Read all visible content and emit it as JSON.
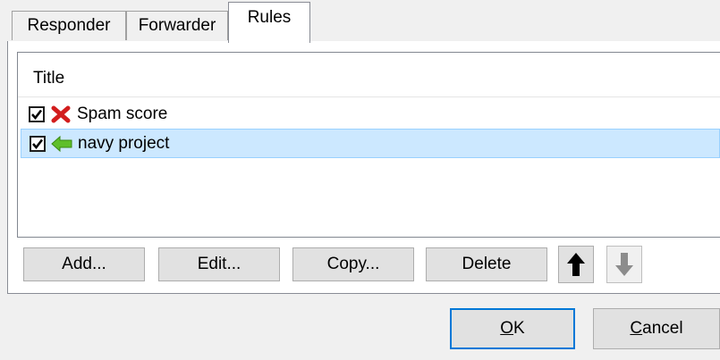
{
  "tabs": [
    {
      "label": "Responder",
      "active": false
    },
    {
      "label": "Forwarder",
      "active": false
    },
    {
      "label": "Rules",
      "active": true
    }
  ],
  "list": {
    "header": "Title",
    "rows": [
      {
        "label": "Spam score",
        "checked": true,
        "icon": "red-x-icon",
        "selected": false
      },
      {
        "label": "navy project",
        "checked": true,
        "icon": "green-left-arrow-icon",
        "selected": true
      }
    ]
  },
  "actions": {
    "add": "Add...",
    "edit": "Edit...",
    "copy": "Copy...",
    "delete": "Delete",
    "move_up_icon": "up-arrow-icon",
    "move_down_icon": "down-arrow-icon"
  },
  "dialog": {
    "ok_mnemonic": "O",
    "ok_rest": "K",
    "cancel_mnemonic": "C",
    "cancel_rest": "ancel"
  },
  "colors": {
    "selection_bg": "#cce8ff",
    "selection_border": "#99d1ff",
    "default_button_border": "#0078d7"
  }
}
